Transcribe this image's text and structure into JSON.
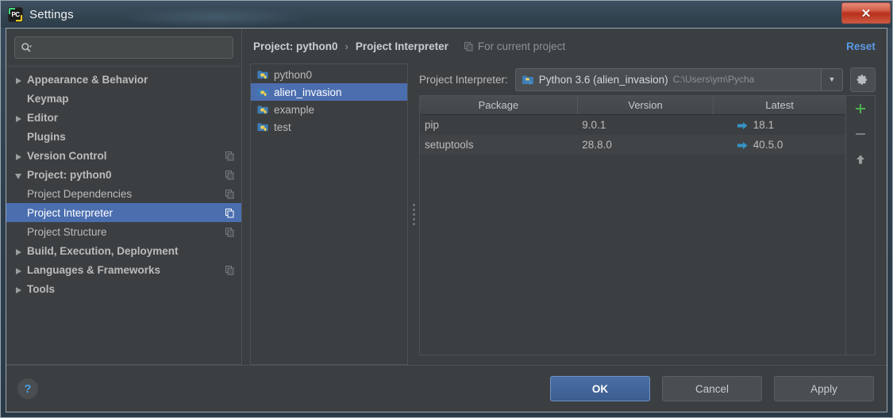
{
  "window": {
    "title": "Settings",
    "app_icon": "pycharm-icon",
    "close_label": "✕"
  },
  "search": {
    "placeholder": "",
    "value": ""
  },
  "sidebar": {
    "items": [
      {
        "label": "Appearance & Behavior",
        "arrow": "collapsed",
        "bold": true,
        "child": false,
        "scope": false,
        "selected": false
      },
      {
        "label": "Keymap",
        "arrow": "none",
        "bold": true,
        "child": false,
        "scope": false,
        "selected": false
      },
      {
        "label": "Editor",
        "arrow": "collapsed",
        "bold": true,
        "child": false,
        "scope": false,
        "selected": false
      },
      {
        "label": "Plugins",
        "arrow": "none",
        "bold": true,
        "child": false,
        "scope": false,
        "selected": false
      },
      {
        "label": "Version Control",
        "arrow": "collapsed",
        "bold": true,
        "child": false,
        "scope": true,
        "selected": false
      },
      {
        "label": "Project: python0",
        "arrow": "expanded",
        "bold": true,
        "child": false,
        "scope": true,
        "selected": false
      },
      {
        "label": "Project Dependencies",
        "arrow": "none",
        "bold": false,
        "child": true,
        "scope": true,
        "selected": false
      },
      {
        "label": "Project Interpreter",
        "arrow": "none",
        "bold": false,
        "child": true,
        "scope": true,
        "selected": true
      },
      {
        "label": "Project Structure",
        "arrow": "none",
        "bold": false,
        "child": true,
        "scope": true,
        "selected": false
      },
      {
        "label": "Build, Execution, Deployment",
        "arrow": "collapsed",
        "bold": true,
        "child": false,
        "scope": false,
        "selected": false
      },
      {
        "label": "Languages & Frameworks",
        "arrow": "collapsed",
        "bold": true,
        "child": false,
        "scope": true,
        "selected": false
      },
      {
        "label": "Tools",
        "arrow": "collapsed",
        "bold": true,
        "child": false,
        "scope": false,
        "selected": false
      }
    ]
  },
  "breadcrumb": {
    "parent": "Project: python0",
    "separator": "›",
    "current": "Project Interpreter",
    "note": "For current project",
    "reset_label": "Reset"
  },
  "projects": {
    "items": [
      {
        "name": "python0",
        "selected": false
      },
      {
        "name": "alien_invasion",
        "selected": true
      },
      {
        "name": "example",
        "selected": false
      },
      {
        "name": "test",
        "selected": false
      }
    ]
  },
  "interpreter": {
    "label": "Project Interpreter:",
    "name": "Python 3.6 (alien_invasion)",
    "path": "C:\\Users\\ym\\Pycha",
    "dropdown_glyph": "▼"
  },
  "packages": {
    "columns": [
      "Package",
      "Version",
      "Latest"
    ],
    "rows": [
      {
        "package": "pip",
        "version": "9.0.1",
        "latest": "18.1"
      },
      {
        "package": "setuptools",
        "version": "28.8.0",
        "latest": "40.5.0"
      }
    ]
  },
  "table_tools": {
    "add_label": "+",
    "remove_label": "−",
    "upgrade_label": "↑"
  },
  "footer": {
    "help_label": "?",
    "ok_label": "OK",
    "cancel_label": "Cancel",
    "apply_label": "Apply"
  },
  "colors": {
    "accent_selection": "#4b6eaf",
    "link": "#5a9ae6",
    "add_green": "#4caf50",
    "upgrade_arrow": "#3592c4",
    "close_red": "#b8301c"
  }
}
